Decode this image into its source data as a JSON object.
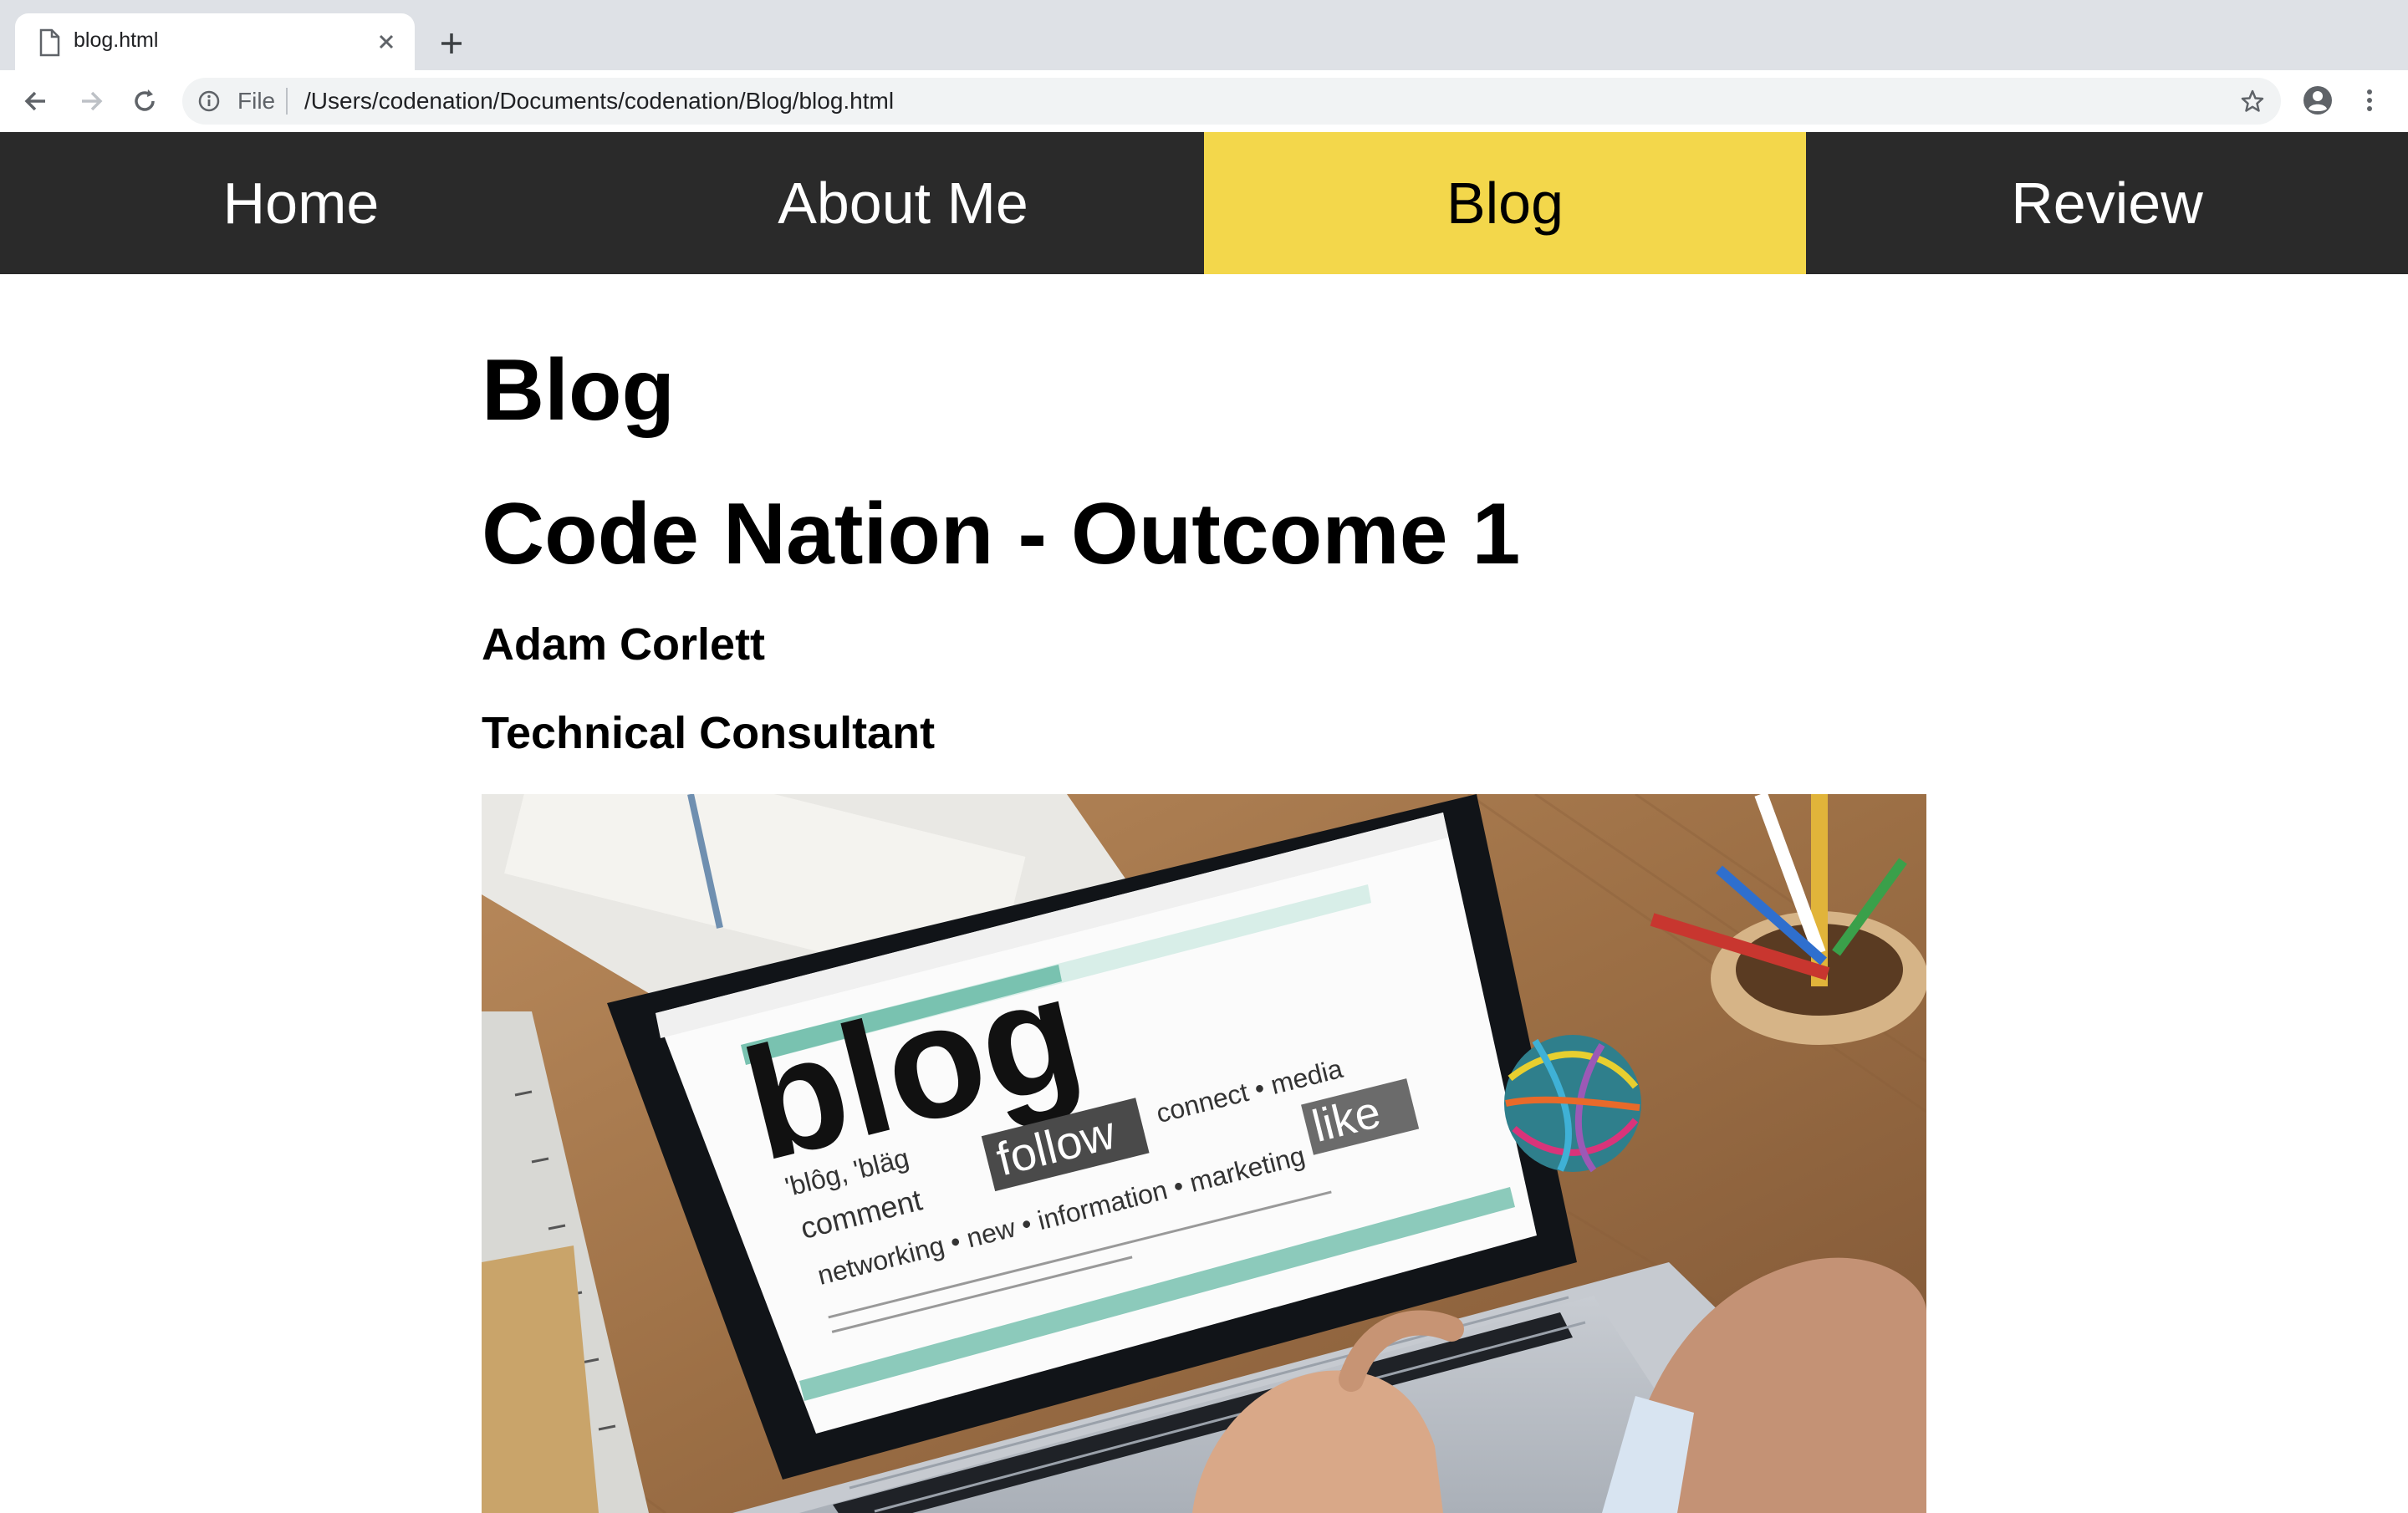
{
  "browser": {
    "tab_title": "blog.html",
    "scheme_label": "File",
    "url": "/Users/codenation/Documents/codenation/Blog/blog.html"
  },
  "nav": {
    "items": [
      {
        "label": "Home",
        "active": false
      },
      {
        "label": "About Me",
        "active": false
      },
      {
        "label": "Blog",
        "active": true
      },
      {
        "label": "Review",
        "active": false
      }
    ],
    "bar_color": "#2a2a2a",
    "active_color": "#f3d74b"
  },
  "content": {
    "page_title": "Blog",
    "post_title": "Code Nation - Outcome 1",
    "author": "Adam Corlett",
    "role": "Technical Consultant"
  },
  "hero_image": {
    "screen_word": "blog",
    "phonetic": "'blôg, 'bläg",
    "keywords_line1": "comment",
    "follow": "follow",
    "connect_media": "connect • media",
    "like": "like",
    "networking_line": "networking • new • information • marketing"
  }
}
